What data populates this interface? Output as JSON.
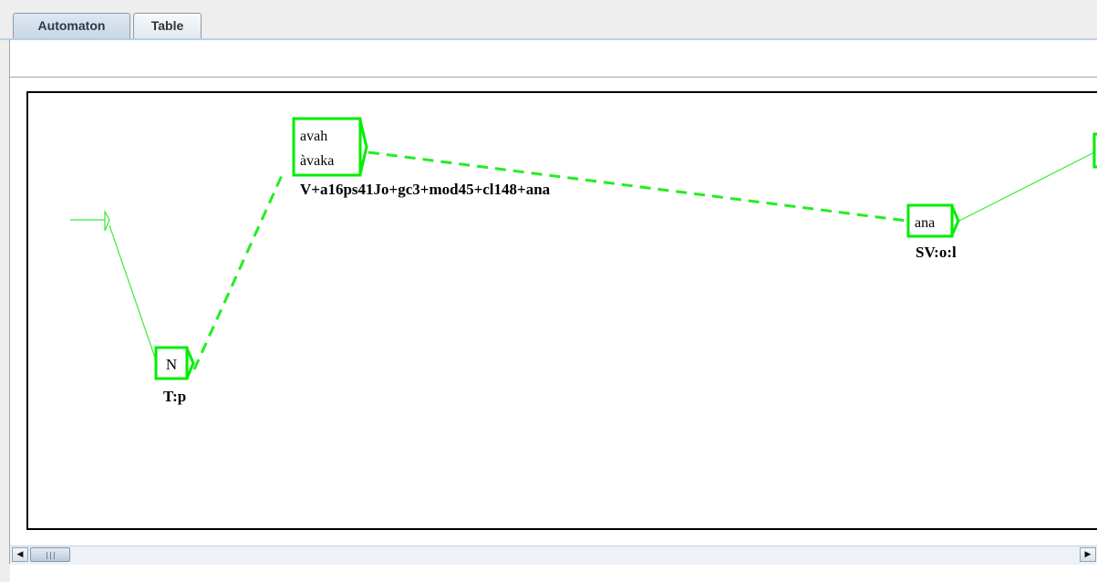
{
  "tabs": [
    {
      "label": "Automaton",
      "selected": true
    },
    {
      "label": "Table",
      "selected": false
    }
  ],
  "graph": {
    "states": {
      "n": {
        "lines": [
          "N"
        ],
        "output": "T:p"
      },
      "avah": {
        "lines": [
          "avah",
          "àvaka"
        ],
        "output": "V+a16ps41Jo+gc3+mod45+cl148+ana"
      },
      "ana": {
        "lines": [
          "ana"
        ],
        "output": "SV:o:l"
      }
    },
    "colors": {
      "node": "#00ee00",
      "edge": "#33ee33",
      "frame": "#000000"
    }
  },
  "scrollbar": {
    "left_arrow": "◀",
    "right_arrow": "▶"
  }
}
